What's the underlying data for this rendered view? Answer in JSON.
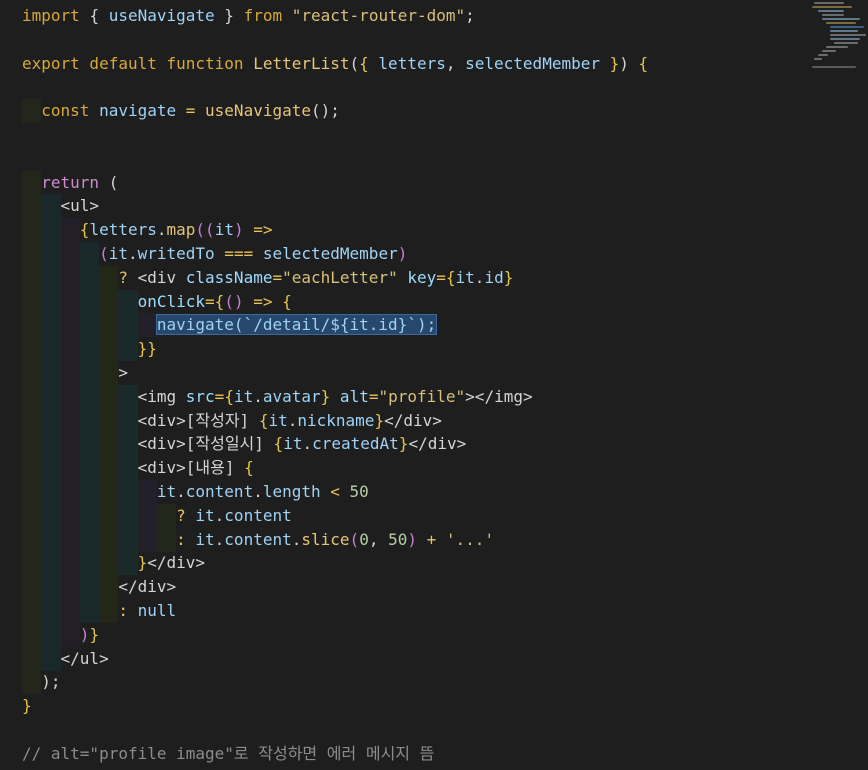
{
  "editor": {
    "language": "javascript-react",
    "colors": {
      "background": "#1e1e1e",
      "keyword": "#d7a93a",
      "string": "#d7c07a",
      "variable": "#9fd3f5",
      "selection": "#27476d",
      "comment": "#8c8c8c"
    },
    "lines": [
      [
        [
          "kw",
          "import "
        ],
        [
          "pun",
          "{ "
        ],
        [
          "var",
          "useNavigate"
        ],
        [
          "pun",
          " } "
        ],
        [
          "kw",
          "from "
        ],
        [
          "str",
          "\"react-router-dom\""
        ],
        [
          "pun",
          ";"
        ]
      ],
      [],
      [
        [
          "kw",
          "export default function "
        ],
        [
          "fn",
          "LetterList"
        ],
        [
          "pun",
          "("
        ],
        [
          "brace",
          "{ "
        ],
        [
          "var",
          "letters"
        ],
        [
          "pun",
          ", "
        ],
        [
          "var",
          "selectedMember"
        ],
        [
          "brace",
          " }"
        ],
        [
          "pun",
          ") "
        ],
        [
          "brace",
          "{"
        ]
      ],
      [],
      [
        [
          "pun",
          "  "
        ],
        [
          "kw",
          "const "
        ],
        [
          "var",
          "navigate"
        ],
        [
          "op",
          " = "
        ],
        [
          "fn",
          "useNavigate"
        ],
        [
          "pun",
          "();"
        ]
      ],
      [],
      [],
      [
        [
          "pun",
          "  "
        ],
        [
          "ctl",
          "return "
        ],
        [
          "pun",
          "("
        ]
      ],
      [
        [
          "pun",
          "    "
        ],
        [
          "tag",
          "<ul>"
        ]
      ],
      [
        [
          "pun",
          "      "
        ],
        [
          "brace",
          "{"
        ],
        [
          "var",
          "letters"
        ],
        [
          "pun",
          "."
        ],
        [
          "fn",
          "map"
        ],
        [
          "brace2",
          "(("
        ],
        [
          "var",
          "it"
        ],
        [
          "brace2",
          ")"
        ],
        [
          "op",
          " =>"
        ]
      ],
      [
        [
          "pun",
          "        "
        ],
        [
          "brace2",
          "("
        ],
        [
          "var",
          "it"
        ],
        [
          "pun",
          "."
        ],
        [
          "var",
          "writedTo"
        ],
        [
          "op",
          " === "
        ],
        [
          "var",
          "selectedMember"
        ],
        [
          "brace2",
          ")"
        ]
      ],
      [
        [
          "pun",
          "          "
        ],
        [
          "op",
          "? "
        ],
        [
          "tag",
          "<div "
        ],
        [
          "attr",
          "className"
        ],
        [
          "op",
          "="
        ],
        [
          "str",
          "\"eachLetter\" "
        ],
        [
          "attr",
          "key"
        ],
        [
          "op",
          "="
        ],
        [
          "brace",
          "{"
        ],
        [
          "var",
          "it"
        ],
        [
          "pun",
          "."
        ],
        [
          "var",
          "id"
        ],
        [
          "brace",
          "}"
        ]
      ],
      [
        [
          "pun",
          "            "
        ],
        [
          "attr",
          "onClick"
        ],
        [
          "op",
          "="
        ],
        [
          "brace",
          "{"
        ],
        [
          "brace2",
          "() "
        ],
        [
          "op",
          "=> "
        ],
        [
          "brace",
          "{"
        ]
      ],
      [
        [
          "pun",
          "              "
        ],
        [
          "sel",
          "navigate(`/detail/${it.id}`);"
        ]
      ],
      [
        [
          "pun",
          "            "
        ],
        [
          "brace",
          "}}"
        ]
      ],
      [
        [
          "pun",
          "          "
        ],
        [
          "tag",
          ">"
        ]
      ],
      [
        [
          "pun",
          "            "
        ],
        [
          "tag",
          "<img "
        ],
        [
          "attr",
          "src"
        ],
        [
          "op",
          "="
        ],
        [
          "brace",
          "{"
        ],
        [
          "var",
          "it"
        ],
        [
          "pun",
          "."
        ],
        [
          "var",
          "avatar"
        ],
        [
          "brace",
          "}"
        ],
        [
          "attr",
          " alt"
        ],
        [
          "op",
          "="
        ],
        [
          "str",
          "\"profile\""
        ],
        [
          "tag",
          "></img>"
        ]
      ],
      [
        [
          "pun",
          "            "
        ],
        [
          "tag",
          "<div>"
        ],
        [
          "txt",
          "[작성자] "
        ],
        [
          "brace",
          "{"
        ],
        [
          "var",
          "it"
        ],
        [
          "pun",
          "."
        ],
        [
          "var",
          "nickname"
        ],
        [
          "brace",
          "}"
        ],
        [
          "tag",
          "</div>"
        ]
      ],
      [
        [
          "pun",
          "            "
        ],
        [
          "tag",
          "<div>"
        ],
        [
          "txt",
          "[작성일시] "
        ],
        [
          "brace",
          "{"
        ],
        [
          "var",
          "it"
        ],
        [
          "pun",
          "."
        ],
        [
          "var",
          "createdAt"
        ],
        [
          "brace",
          "}"
        ],
        [
          "tag",
          "</div>"
        ]
      ],
      [
        [
          "pun",
          "            "
        ],
        [
          "tag",
          "<div>"
        ],
        [
          "txt",
          "[내용] "
        ],
        [
          "brace",
          "{"
        ]
      ],
      [
        [
          "pun",
          "              "
        ],
        [
          "var",
          "it"
        ],
        [
          "pun",
          "."
        ],
        [
          "var",
          "content"
        ],
        [
          "pun",
          "."
        ],
        [
          "var",
          "length"
        ],
        [
          "op",
          " < "
        ],
        [
          "num",
          "50"
        ]
      ],
      [
        [
          "pun",
          "                "
        ],
        [
          "op",
          "? "
        ],
        [
          "var",
          "it"
        ],
        [
          "pun",
          "."
        ],
        [
          "var",
          "content"
        ]
      ],
      [
        [
          "pun",
          "                "
        ],
        [
          "op",
          ": "
        ],
        [
          "var",
          "it"
        ],
        [
          "pun",
          "."
        ],
        [
          "var",
          "content"
        ],
        [
          "pun",
          "."
        ],
        [
          "fn",
          "slice"
        ],
        [
          "brace2",
          "("
        ],
        [
          "num",
          "0"
        ],
        [
          "pun",
          ", "
        ],
        [
          "num",
          "50"
        ],
        [
          "brace2",
          ")"
        ],
        [
          "op",
          " + "
        ],
        [
          "str",
          "'...'"
        ]
      ],
      [
        [
          "pun",
          "            "
        ],
        [
          "brace",
          "}"
        ],
        [
          "tag",
          "</div>"
        ]
      ],
      [
        [
          "pun",
          "          "
        ],
        [
          "tag",
          "</div>"
        ]
      ],
      [
        [
          "pun",
          "          "
        ],
        [
          "op",
          ": "
        ],
        [
          "var",
          "null"
        ]
      ],
      [
        [
          "pun",
          "      "
        ],
        [
          "brace2",
          ")"
        ],
        [
          "brace",
          "}"
        ]
      ],
      [
        [
          "pun",
          "    "
        ],
        [
          "tag",
          "</ul>"
        ]
      ],
      [
        [
          "pun",
          "  "
        ],
        [
          "pun",
          ");"
        ]
      ],
      [
        [
          "brace",
          "}"
        ]
      ],
      [],
      [
        [
          "cmt",
          "// alt=\"profile image\"로 작성하면 에러 메시지 뜸"
        ]
      ]
    ]
  }
}
